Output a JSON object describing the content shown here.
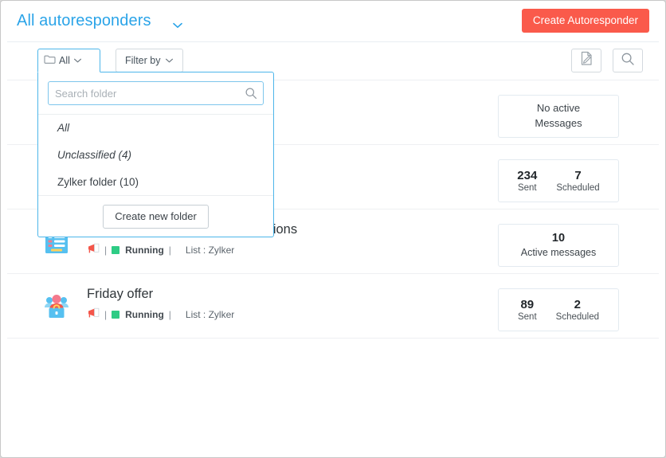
{
  "header": {
    "title": "All autoresponders",
    "title_caret_icon": "chevron-down-icon",
    "create_button": "Create Autoresponder",
    "accent_color": "#fa5a4b",
    "title_color": "#2ba4e8"
  },
  "toolbar": {
    "folder_button": {
      "label": "All",
      "icon": "folder-icon",
      "caret_icon": "chevron-down-icon"
    },
    "filter_button": {
      "label": "Filter by",
      "caret_icon": "chevron-down-icon"
    },
    "compose_button_icon": "note-edit-icon",
    "search_button_icon": "search-icon"
  },
  "folder_dropdown": {
    "open": true,
    "search": {
      "value": "",
      "placeholder": "Search folder",
      "icon": "search-icon"
    },
    "items": [
      {
        "label": "All",
        "italic": true
      },
      {
        "label": "Unclassified (4)",
        "italic": true
      },
      {
        "label": "Zylker folder (10)",
        "italic": false
      }
    ],
    "create_folder_button": "Create new folder"
  },
  "list": {
    "rows": [
      {
        "hidden_by_dropdown": true,
        "icon": "campaign-icon",
        "title": "",
        "megaphone_icon": "megaphone-icon",
        "status": "",
        "list_label": "",
        "stat": {
          "type": "empty",
          "line1": "No active",
          "line2": "Messages"
        }
      },
      {
        "hidden_by_dropdown": true,
        "icon": "campaign-icon",
        "title": "",
        "megaphone_icon": "megaphone-icon",
        "status": "",
        "list_label": "",
        "stat": {
          "type": "pair",
          "cells": [
            {
              "num": "234",
              "lab": "Sent"
            },
            {
              "num": "7",
              "lab": "Scheduled"
            }
          ]
        }
      },
      {
        "hidden_by_dropdown": false,
        "icon": "newsletter-icon",
        "title": "Christmas and new year promotions",
        "megaphone_icon": "megaphone-icon",
        "status": "Running",
        "status_color": "#2ecc85",
        "list_label": "List : Zylker",
        "stat": {
          "type": "single",
          "num": "10",
          "lab": "Active messages"
        }
      },
      {
        "hidden_by_dropdown": false,
        "icon": "audience-icon",
        "title": "Friday offer",
        "megaphone_icon": "megaphone-icon",
        "status": "Running",
        "status_color": "#2ecc85",
        "list_label": "List : Zylker",
        "stat": {
          "type": "pair",
          "cells": [
            {
              "num": "89",
              "lab": "Sent"
            },
            {
              "num": "2",
              "lab": "Scheduled"
            }
          ]
        }
      }
    ],
    "separators": {
      "meta_pipe": "|"
    }
  }
}
